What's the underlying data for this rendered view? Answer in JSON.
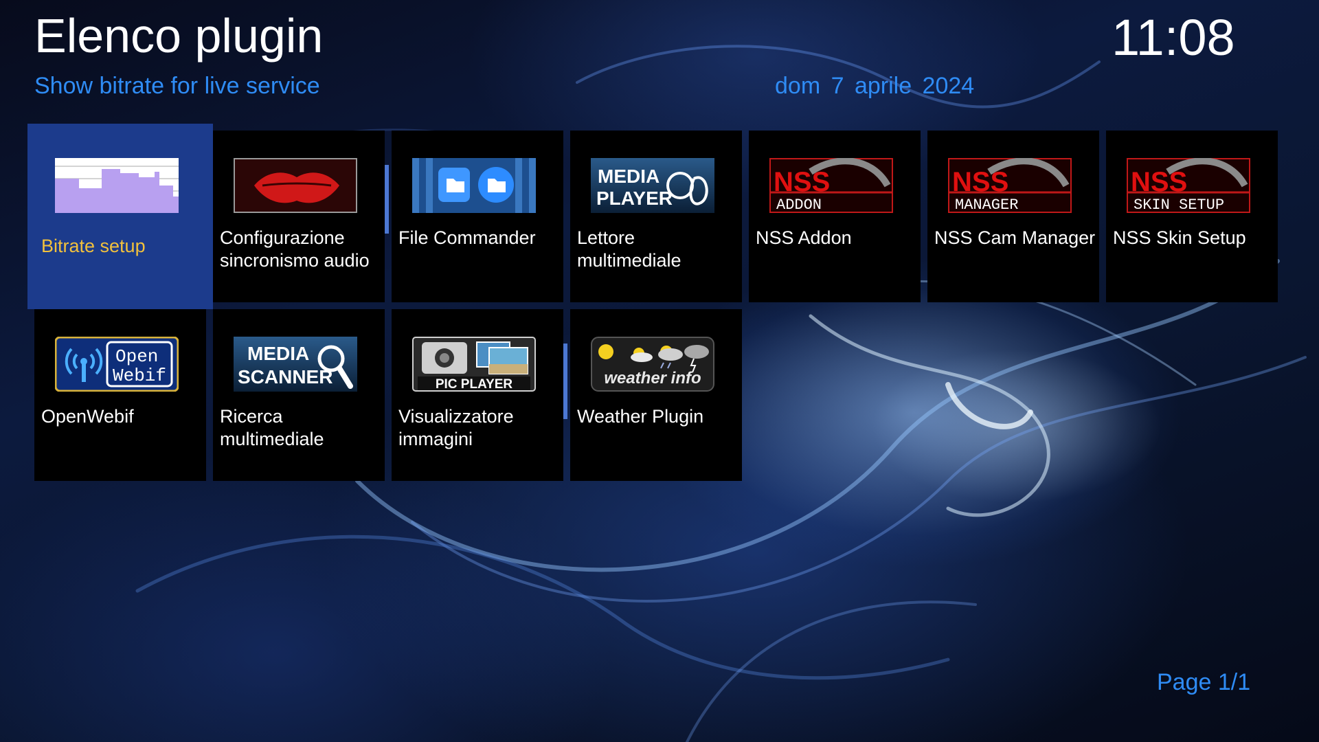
{
  "header": {
    "title": "Elenco plugin",
    "subtitle": "Show bitrate for live service",
    "date": "dom  7 aprile 2024",
    "clock": "11:08"
  },
  "plugins": [
    {
      "label": "Bitrate setup",
      "icon": "bitrate-graph-icon",
      "selected": true
    },
    {
      "label": "Configurazione sincronismo audio",
      "icon": "lips-icon"
    },
    {
      "label": "File Commander",
      "icon": "folders-icon"
    },
    {
      "label": "Lettore multimediale",
      "icon": "media-player-icon",
      "icon_text": "MEDIA PLAYER"
    },
    {
      "label": "NSS Addon",
      "icon": "nss-logo-icon",
      "icon_text": "ADDON",
      "logo_text": "NSS"
    },
    {
      "label": "NSS Cam Manager",
      "icon": "nss-logo-icon",
      "icon_text": "MANAGER",
      "logo_text": "NSS"
    },
    {
      "label": "NSS Skin Setup",
      "icon": "nss-logo-icon",
      "icon_text": "SKIN SETUP",
      "logo_text": "NSS"
    },
    {
      "label": "OpenWebif",
      "icon": "openwebif-icon",
      "icon_text": "Open Webif"
    },
    {
      "label": "Ricerca multimediale",
      "icon": "media-scanner-icon",
      "icon_text": "MEDIA SCANNER"
    },
    {
      "label": "Visualizzatore immagini",
      "icon": "pic-player-icon",
      "icon_text": "PIC PLAYER"
    },
    {
      "label": "Weather Plugin",
      "icon": "weather-icon",
      "icon_text": "weather info"
    }
  ],
  "footer": {
    "page": "Page 1/1"
  },
  "colors": {
    "accent_blue": "#2f8cf5",
    "selected_bg": "#1c3b8c",
    "selected_text": "#f2c13c",
    "tile_bg": "#000000"
  }
}
